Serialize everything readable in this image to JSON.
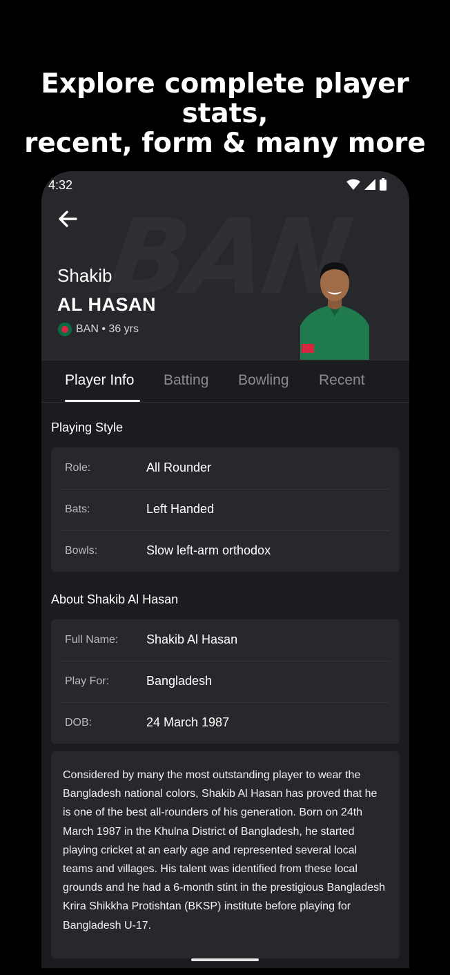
{
  "headline": {
    "line1": "Explore complete player stats,",
    "line2": "recent, form & many more"
  },
  "status_bar": {
    "time": "4:32",
    "icons": [
      "wifi-icon",
      "signal-icon",
      "battery-icon"
    ]
  },
  "header": {
    "watermark": "BAN",
    "first_name": "Shakib",
    "last_name": "AL HASAN",
    "country_code": "BAN",
    "age": "36 yrs",
    "flag_colors": {
      "field": "#0a6a44",
      "disc": "#d7263d"
    }
  },
  "tabs": [
    {
      "label": "Player Info",
      "active": true
    },
    {
      "label": "Batting",
      "active": false
    },
    {
      "label": "Bowling",
      "active": false
    },
    {
      "label": "Recent",
      "active": false
    }
  ],
  "playing_style": {
    "title": "Playing Style",
    "rows": [
      {
        "label": "Role:",
        "value": "All Rounder"
      },
      {
        "label": "Bats:",
        "value": "Left Handed"
      },
      {
        "label": "Bowls:",
        "value": "Slow left-arm orthodox"
      }
    ]
  },
  "about": {
    "title": "About Shakib Al Hasan",
    "rows": [
      {
        "label": "Full Name:",
        "value": "Shakib Al Hasan"
      },
      {
        "label": "Play For:",
        "value": "Bangladesh"
      },
      {
        "label": "DOB:",
        "value": "24 March 1987"
      }
    ],
    "bio": "Considered by many the most outstanding player to wear the Bangladesh national colors, Shakib Al Hasan has proved that he is one of the best all-rounders of his generation. Born on 24th March 1987 in the Khulna District of Bangladesh, he started playing cricket at an early age and represented several local teams and villages. His talent was identified from these local grounds and he had a 6-month stint in the prestigious Bangladesh Krira Shikkha Protishtan (BKSP) institute before playing for Bangladesh U-17."
  },
  "colors": {
    "background": "#000000",
    "surface": "#1b1c20",
    "card": "#27282c",
    "tab_inactive": "#8a8b90",
    "text": "#ffffff"
  }
}
